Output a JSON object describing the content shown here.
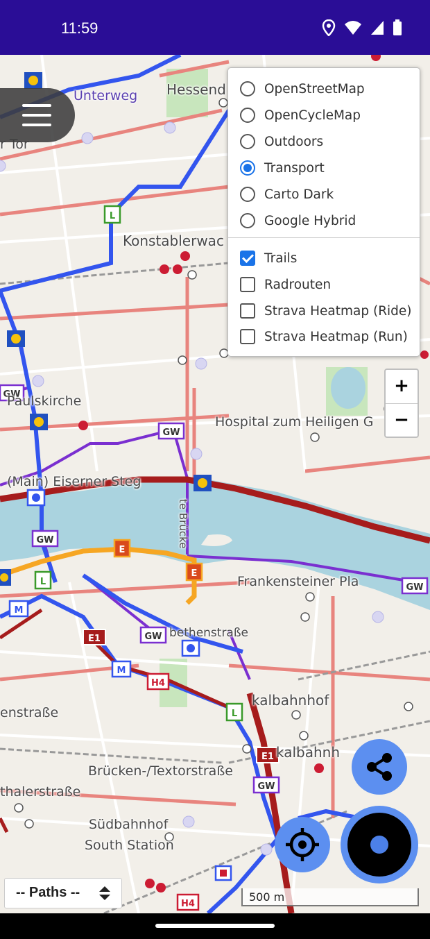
{
  "status_bar": {
    "time": "11:59",
    "icons": [
      "location-icon",
      "wifi-icon",
      "signal-icon",
      "battery-icon"
    ]
  },
  "map": {
    "place_labels": [
      "Unterweg",
      "Hessend",
      "r Tor",
      "Konstablerwac",
      "Paulskirche",
      "Hospital zum Heiligen G",
      "(Main) Eiserner Steg",
      "te Brücke",
      "Frankensteiner Pla",
      "bethenstraße",
      "kalbahnhof",
      "enstraße",
      "kalbahnh",
      "Brücken-/Textorstraße",
      "thalerstraße",
      "Südbahnhof",
      "South Station"
    ],
    "route_badges": [
      "L",
      "GW",
      "E",
      "M",
      "E1",
      "H4"
    ],
    "colors": {
      "water": "#aad3df",
      "main_road": "#e8847e",
      "trail_blue": "#3355ee",
      "trail_purple": "#7a2fd0",
      "trail_darkred": "#a61c1c",
      "trail_orange": "#f6a623"
    }
  },
  "layer_switcher": {
    "base_layers": [
      {
        "label": "OpenStreetMap",
        "selected": false
      },
      {
        "label": "OpenCycleMap",
        "selected": false
      },
      {
        "label": "Outdoors",
        "selected": false
      },
      {
        "label": "Transport",
        "selected": true
      },
      {
        "label": "Carto Dark",
        "selected": false
      },
      {
        "label": "Google Hybrid",
        "selected": false
      }
    ],
    "overlays": [
      {
        "label": "Trails",
        "checked": true
      },
      {
        "label": "Radrouten",
        "checked": false
      },
      {
        "label": "Strava Heatmap (Ride)",
        "checked": false
      },
      {
        "label": "Strava Heatmap (Run)",
        "checked": false
      }
    ]
  },
  "zoom": {
    "in_label": "+",
    "out_label": "−"
  },
  "paths_select": {
    "value": "-- Paths --"
  },
  "scale": {
    "label": "500 m"
  },
  "buttons": {
    "share": "share-icon",
    "locate": "crosshair-icon",
    "record": "record-icon",
    "menu": "hamburger-menu-icon"
  }
}
